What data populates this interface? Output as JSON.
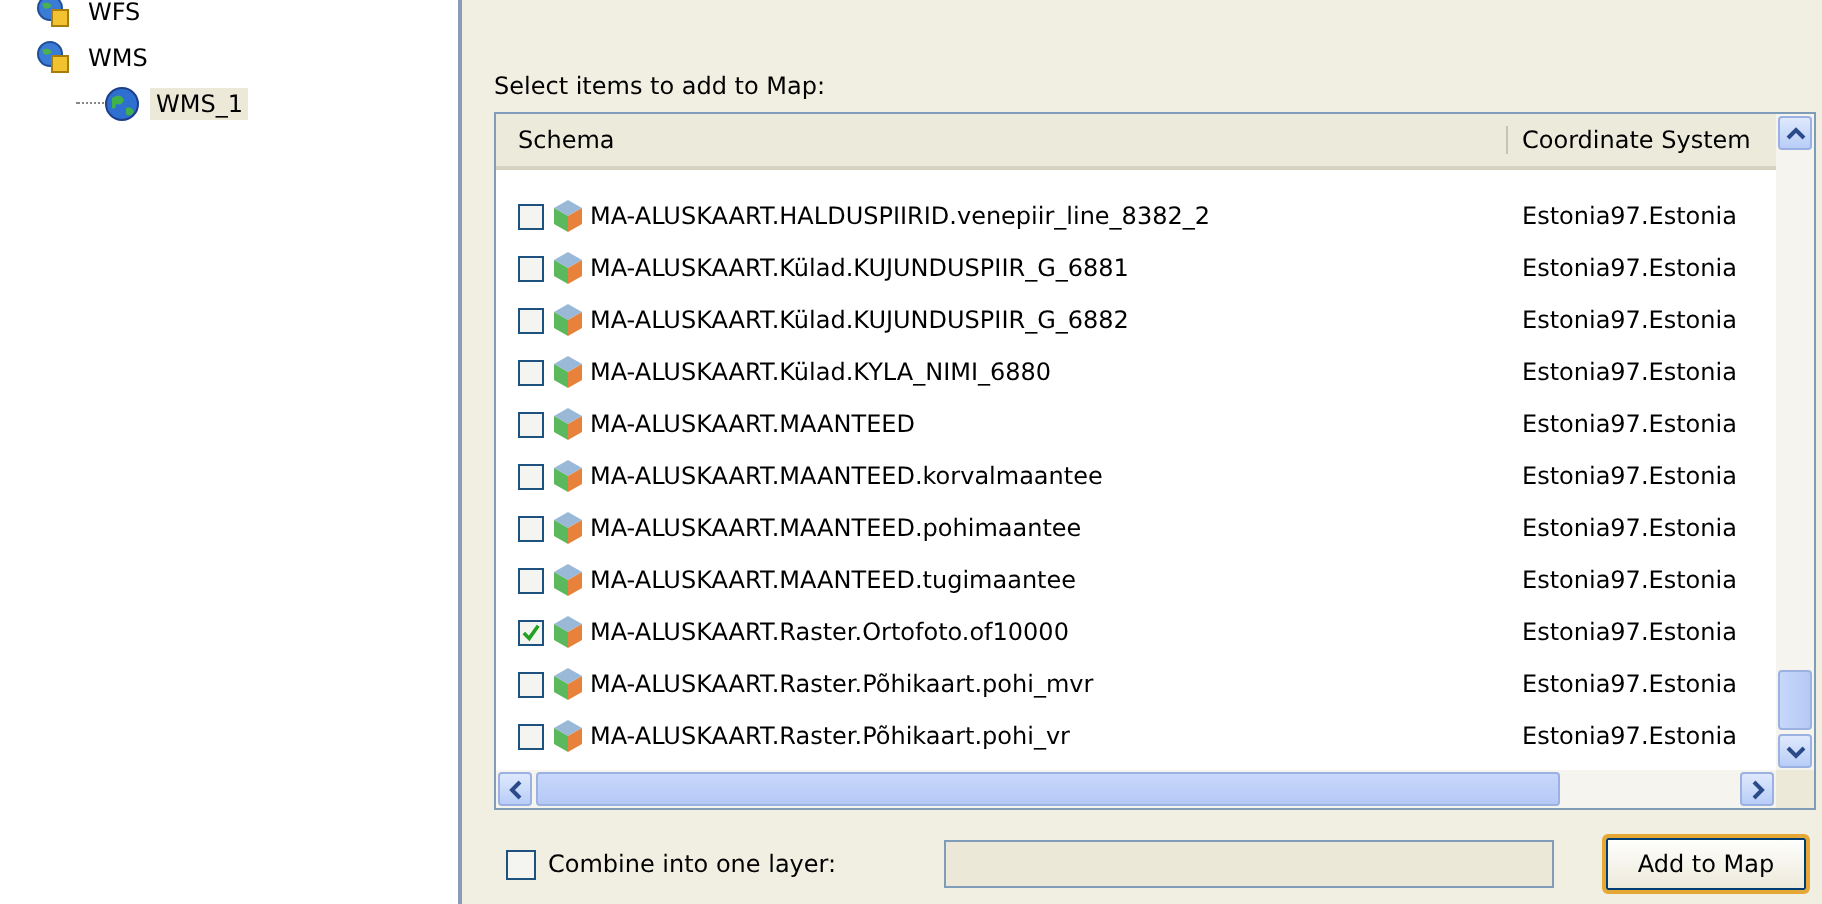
{
  "tree": [
    {
      "label": "WFS",
      "kind": "service",
      "selected": false
    },
    {
      "label": "WMS",
      "kind": "service",
      "selected": false,
      "children": [
        {
          "label": "WMS_1",
          "kind": "layer",
          "selected": true
        }
      ]
    }
  ],
  "prompt": "Select items to add to Map:",
  "table": {
    "columns": [
      "Schema",
      "Coordinate System"
    ],
    "rows": [
      {
        "schema": "MA-ALUSKAART.HALDUSPIIRID.venepiir_line_8382_2",
        "crs": "Estonia97.Estonia",
        "checked": false
      },
      {
        "schema": "MA-ALUSKAART.Külad.KUJUNDUSPIIR_G_6881",
        "crs": "Estonia97.Estonia",
        "checked": false
      },
      {
        "schema": "MA-ALUSKAART.Külad.KUJUNDUSPIIR_G_6882",
        "crs": "Estonia97.Estonia",
        "checked": false
      },
      {
        "schema": "MA-ALUSKAART.Külad.KYLA_NIMI_6880",
        "crs": "Estonia97.Estonia",
        "checked": false
      },
      {
        "schema": "MA-ALUSKAART.MAANTEED",
        "crs": "Estonia97.Estonia",
        "checked": false
      },
      {
        "schema": "MA-ALUSKAART.MAANTEED.korvalmaantee",
        "crs": "Estonia97.Estonia",
        "checked": false
      },
      {
        "schema": "MA-ALUSKAART.MAANTEED.pohimaantee",
        "crs": "Estonia97.Estonia",
        "checked": false
      },
      {
        "schema": "MA-ALUSKAART.MAANTEED.tugimaantee",
        "crs": "Estonia97.Estonia",
        "checked": false
      },
      {
        "schema": "MA-ALUSKAART.Raster.Ortofoto.of10000",
        "crs": "Estonia97.Estonia",
        "checked": true
      },
      {
        "schema": "MA-ALUSKAART.Raster.Põhikaart.pohi_mvr",
        "crs": "Estonia97.Estonia",
        "checked": false
      },
      {
        "schema": "MA-ALUSKAART.Raster.Põhikaart.pohi_vr",
        "crs": "Estonia97.Estonia",
        "checked": false
      }
    ]
  },
  "combine": {
    "label": "Combine into one layer:",
    "checked": false
  },
  "button": "Add to Map"
}
